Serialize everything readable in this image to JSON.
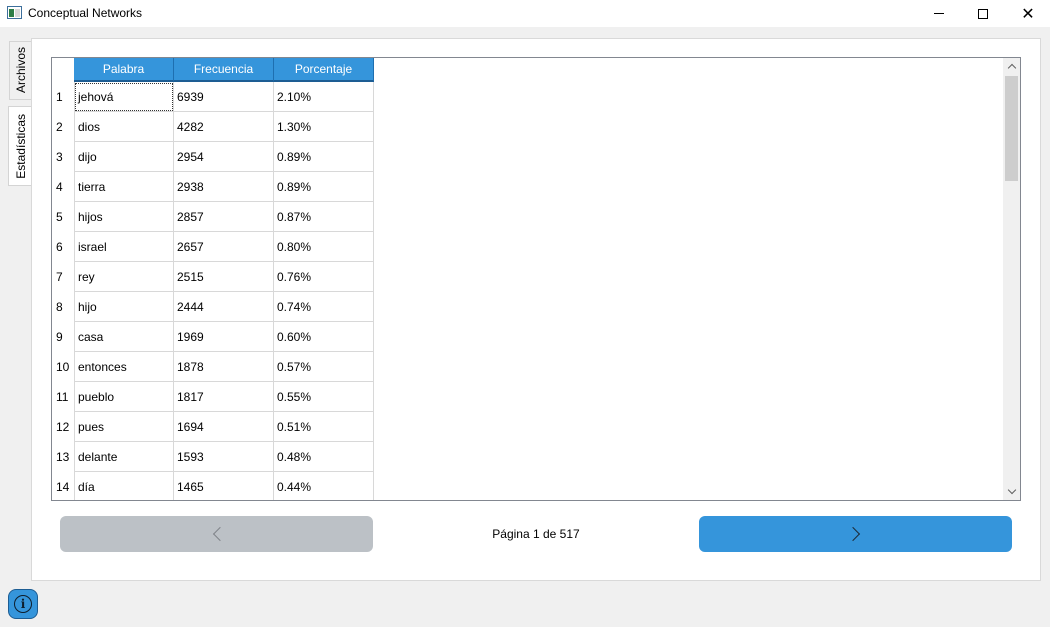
{
  "window": {
    "title": "Conceptual Networks",
    "minimize_glyph": "",
    "close_glyph": "✕"
  },
  "tabs": [
    {
      "label": "Archivos",
      "active": false
    },
    {
      "label": "Estadísticas",
      "active": true
    }
  ],
  "table": {
    "columns": [
      "Palabra",
      "Frecuencia",
      "Porcentaje"
    ],
    "rows": [
      {
        "n": "1",
        "palabra": "jehová",
        "frecuencia": "6939",
        "porcentaje": "2.10%"
      },
      {
        "n": "2",
        "palabra": "dios",
        "frecuencia": "4282",
        "porcentaje": "1.30%"
      },
      {
        "n": "3",
        "palabra": "dijo",
        "frecuencia": "2954",
        "porcentaje": "0.89%"
      },
      {
        "n": "4",
        "palabra": "tierra",
        "frecuencia": "2938",
        "porcentaje": "0.89%"
      },
      {
        "n": "5",
        "palabra": "hijos",
        "frecuencia": "2857",
        "porcentaje": "0.87%"
      },
      {
        "n": "6",
        "palabra": "israel",
        "frecuencia": "2657",
        "porcentaje": "0.80%"
      },
      {
        "n": "7",
        "palabra": "rey",
        "frecuencia": "2515",
        "porcentaje": "0.76%"
      },
      {
        "n": "8",
        "palabra": "hijo",
        "frecuencia": "2444",
        "porcentaje": "0.74%"
      },
      {
        "n": "9",
        "palabra": "casa",
        "frecuencia": "1969",
        "porcentaje": "0.60%"
      },
      {
        "n": "10",
        "palabra": "entonces",
        "frecuencia": "1878",
        "porcentaje": "0.57%"
      },
      {
        "n": "11",
        "palabra": "pueblo",
        "frecuencia": "1817",
        "porcentaje": "0.55%"
      },
      {
        "n": "12",
        "palabra": "pues",
        "frecuencia": "1694",
        "porcentaje": "0.51%"
      },
      {
        "n": "13",
        "palabra": "delante",
        "frecuencia": "1593",
        "porcentaje": "0.48%"
      },
      {
        "n": "14",
        "palabra": "día",
        "frecuencia": "1465",
        "porcentaje": "0.44%"
      }
    ]
  },
  "pagination": {
    "label": "Página 1 de 517",
    "prev_enabled": false,
    "next_enabled": true
  },
  "colors": {
    "accent": "#3595db",
    "disabled": "#bcc1c6"
  },
  "icons": {
    "prev": "chevron-left-icon",
    "next": "chevron-right-icon",
    "info": "info-icon"
  }
}
